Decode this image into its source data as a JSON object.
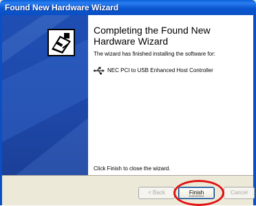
{
  "window": {
    "title": "Found New Hardware Wizard"
  },
  "content": {
    "heading": "Completing the Found New Hardware Wizard",
    "description": "The wizard has finished installing the software for:",
    "device": {
      "icon": "usb-icon",
      "name": "NEC PCI to USB Enhanced Host Controller"
    },
    "close_note": "Click Finish to close the wizard."
  },
  "buttons": {
    "back": "< Back",
    "finish": "Finish",
    "cancel": "Cancel"
  },
  "colors": {
    "titlebar": "#0a5fd8",
    "sidebar": "#1f4fb4",
    "highlight": "#e01010"
  }
}
